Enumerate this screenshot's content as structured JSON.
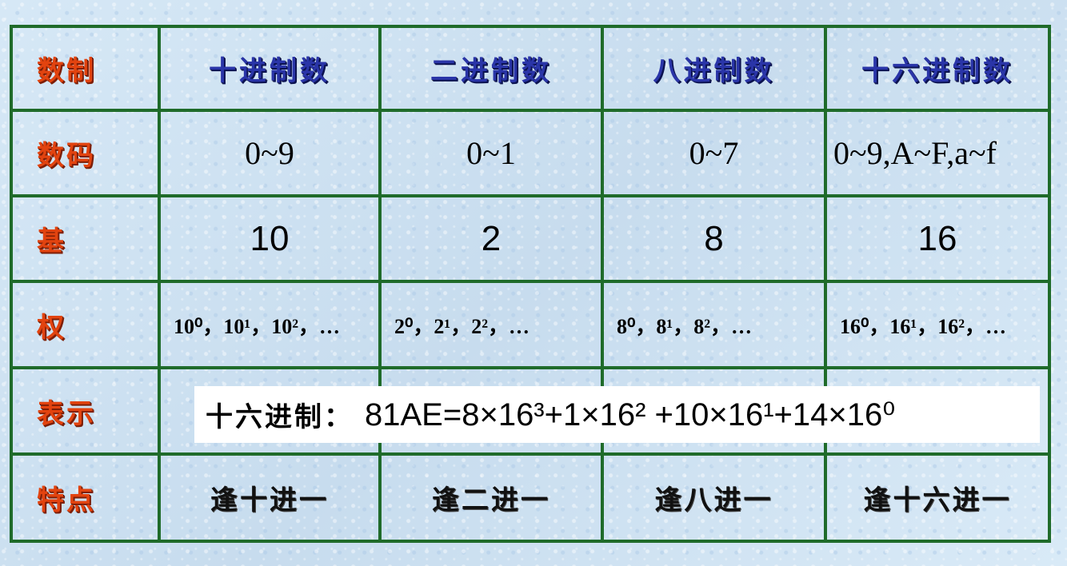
{
  "header": {
    "corner": "数制",
    "columns": [
      "十进制数",
      "二进制数",
      "八进制数",
      "十六进制数"
    ]
  },
  "rows": {
    "digits": {
      "label": "数码",
      "values": [
        "0~9",
        "0~1",
        "0~7",
        "0~9,A~F,a~f"
      ]
    },
    "base": {
      "label": "基",
      "values": [
        "10",
        "2",
        "8",
        "16"
      ]
    },
    "weight": {
      "label": "权",
      "values": [
        "10⁰，10¹，10²，…",
        "2⁰，2¹，2²，…",
        "8⁰，8¹，8²，…",
        "16⁰，16¹，16²，…"
      ]
    },
    "representation": {
      "label": "表示"
    },
    "feature": {
      "label": "特点",
      "values": [
        "逢十进一",
        "逢二进一",
        "逢八进一",
        "逢十六进一"
      ]
    }
  },
  "example": {
    "label": "十六进制：",
    "formula": "81AE=8×16³+1×16² +10×16¹+14×16⁰"
  }
}
